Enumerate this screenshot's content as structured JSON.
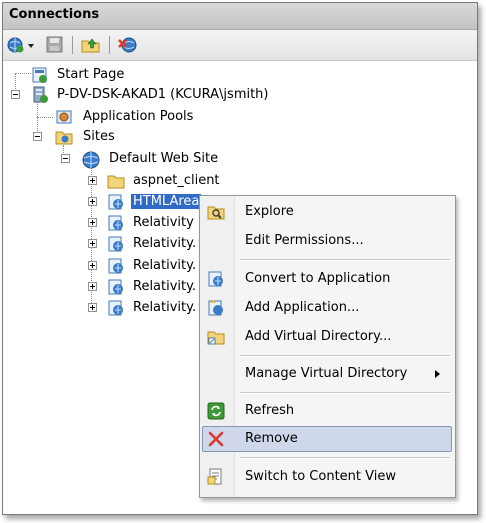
{
  "panel": {
    "title": "Connections"
  },
  "toolbar": {
    "icons": [
      "connect-globe-icon",
      "save-icon",
      "up-folder-icon",
      "disconnect-icon"
    ]
  },
  "tree": {
    "start_page": "Start Page",
    "server": "P-DV-DSK-AKAD1 (KCURA\\jsmith)",
    "app_pools": "Application Pools",
    "sites": "Sites",
    "default_site": "Default Web Site",
    "children": [
      "aspnet_client",
      "HTMLArea",
      "Relativity",
      "Relativity.",
      "Relativity.",
      "Relativity.",
      "Relativity."
    ]
  },
  "context_menu": {
    "explore": "Explore",
    "edit_permissions": "Edit Permissions...",
    "convert": "Convert to Application",
    "add_application": "Add Application...",
    "add_vdir": "Add Virtual Directory...",
    "manage_vdir": "Manage Virtual Directory",
    "refresh": "Refresh",
    "remove": "Remove",
    "switch_content": "Switch to Content View"
  },
  "colors": {
    "selection": "#3169c6",
    "menu_highlight": "#cfd8ea",
    "remove_x": "#d93a2b"
  }
}
